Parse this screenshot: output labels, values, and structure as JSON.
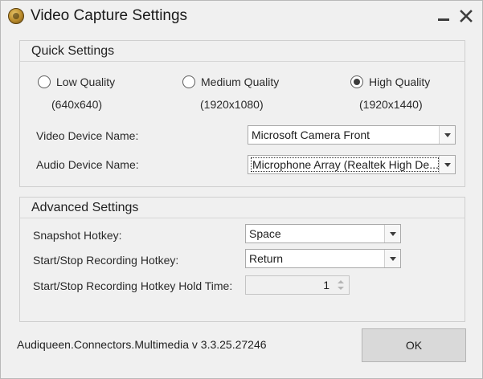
{
  "window": {
    "title": "Video Capture Settings"
  },
  "quick": {
    "title": "Quick Settings",
    "options": [
      {
        "label": "Low Quality",
        "resolution": "(640x640)",
        "checked": false
      },
      {
        "label": "Medium Quality",
        "resolution": "(1920x1080)",
        "checked": false
      },
      {
        "label": "High Quality",
        "resolution": "(1920x1440)",
        "checked": true
      }
    ],
    "video_label": "Video Device Name:",
    "video_value": "Microsoft Camera Front",
    "audio_label": "Audio Device Name:",
    "audio_value": "Microphone Array (Realtek High De..."
  },
  "advanced": {
    "title": "Advanced Settings",
    "snapshot_label": "Snapshot Hotkey:",
    "snapshot_value": "Space",
    "record_label": "Start/Stop Recording Hotkey:",
    "record_value": "Return",
    "hold_label": "Start/Stop Recording Hotkey Hold Time:",
    "hold_value": "1"
  },
  "footer": {
    "version": "Audiqueen.Connectors.Multimedia v 3.3.25.27246",
    "ok_label": "OK"
  },
  "icons": {
    "app": "app-logo-icon",
    "minimize": "minimize-icon",
    "close": "close-icon"
  }
}
